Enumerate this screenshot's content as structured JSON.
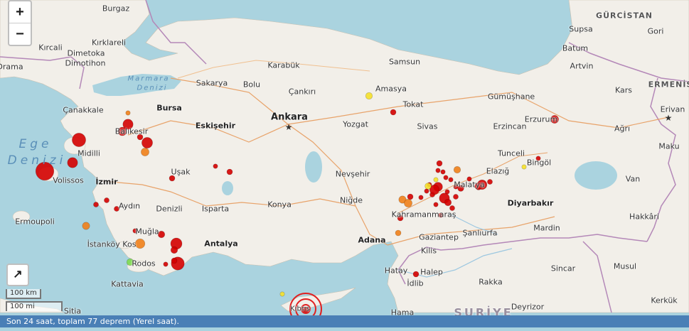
{
  "controls": {
    "zoom_in": "+",
    "zoom_out": "−",
    "fullscreen_glyph": "↗"
  },
  "scale": {
    "metric": "100 km",
    "imperial": "100 mi"
  },
  "status_text": "Son 24 saat, toplam 77 deprem (Yerel saat).",
  "colors": {
    "sea": "#aad3df",
    "land": "#f2efe9",
    "border": "#b488b8",
    "status_bar": "#4a7fb6",
    "quake_red": "#d40000",
    "quake_orange": "#f07f1a",
    "quake_yellow": "#f5e02a",
    "quake_green": "#7fdc50"
  },
  "labels": [
    {
      "text": "Burgaz"
    },
    {
      "text": "GÜRCİSTAN"
    },
    {
      "text": "Supsa"
    },
    {
      "text": "Gori"
    },
    {
      "text": "Kırklareli"
    },
    {
      "text": "Kırcali"
    },
    {
      "text": "Dimetoka"
    },
    {
      "text": "Batum"
    },
    {
      "text": "Dimotihon"
    },
    {
      "text": "Artvin"
    },
    {
      "text": "Drama"
    },
    {
      "text": "Karabük"
    },
    {
      "text": "Samsun"
    },
    {
      "text": "Marmara"
    },
    {
      "text": "Denizi"
    },
    {
      "text": "Sakarya"
    },
    {
      "text": "Bolu"
    },
    {
      "text": "Çankırı"
    },
    {
      "text": "Amasya"
    },
    {
      "text": "Kars"
    },
    {
      "text": "ERMENİS"
    },
    {
      "text": "Çanakkale"
    },
    {
      "text": "Bursa"
    },
    {
      "text": "Gümüşhane"
    },
    {
      "text": "Tokat"
    },
    {
      "text": "Erivan"
    },
    {
      "text": "Ankara"
    },
    {
      "text": "Balıkesir"
    },
    {
      "text": "Eskişehir"
    },
    {
      "text": "Yozgat"
    },
    {
      "text": "Sivas"
    },
    {
      "text": "Erzincan"
    },
    {
      "text": "Erzurum"
    },
    {
      "text": "Ağrı"
    },
    {
      "text": "Ege"
    },
    {
      "text": "Denizi"
    },
    {
      "text": "Midilli"
    },
    {
      "text": "Maku"
    },
    {
      "text": "Tunceli"
    },
    {
      "text": "Bingöl"
    },
    {
      "text": "Uşak"
    },
    {
      "text": "Volissos"
    },
    {
      "text": "Nevşehir"
    },
    {
      "text": "Elazığ"
    },
    {
      "text": "İzmir"
    },
    {
      "text": "Malatya"
    },
    {
      "text": "Van"
    },
    {
      "text": "Niğde"
    },
    {
      "text": "Aydın"
    },
    {
      "text": "Denizli"
    },
    {
      "text": "Isparta"
    },
    {
      "text": "Konya"
    },
    {
      "text": "Diyarbakır"
    },
    {
      "text": "Kahramanmaraş"
    },
    {
      "text": "Ermoupoli"
    },
    {
      "text": "Hakkâri"
    },
    {
      "text": "Muğla"
    },
    {
      "text": "Mardin"
    },
    {
      "text": "Gaziantep"
    },
    {
      "text": "Şanlıurfa"
    },
    {
      "text": "Adana"
    },
    {
      "text": "İstanköy Kos"
    },
    {
      "text": "Antalya"
    },
    {
      "text": "Kilis"
    },
    {
      "text": "Rodos"
    },
    {
      "text": "Sincar"
    },
    {
      "text": "Musul"
    },
    {
      "text": "Hatay"
    },
    {
      "text": "Halep"
    },
    {
      "text": "Kattavia"
    },
    {
      "text": "İdlib"
    },
    {
      "text": "Rakka"
    },
    {
      "text": "Kerkük"
    },
    {
      "text": "Deyrizor"
    },
    {
      "text": "Sitia"
    },
    {
      "text": "Hama"
    },
    {
      "text": "SURİYE"
    },
    {
      "text": "Kıbrıs"
    }
  ],
  "earthquakes": [
    {
      "id": "q1",
      "color": "red",
      "mag": 4.4
    },
    {
      "id": "q2",
      "color": "red",
      "mag": 3.6
    },
    {
      "id": "q3",
      "color": "red",
      "mag": 3.0
    },
    {
      "id": "q4",
      "color": "orange",
      "mag": 2.0
    },
    {
      "id": "q5",
      "color": "red",
      "mag": 3.0
    },
    {
      "id": "q6",
      "color": "red",
      "mag": 2.7
    },
    {
      "id": "q7",
      "color": "red",
      "mag": 2.2
    },
    {
      "id": "q8",
      "color": "orange",
      "mag": 2.6
    },
    {
      "id": "q9",
      "color": "red",
      "mag": 3.1
    },
    {
      "id": "q10",
      "color": "red",
      "mag": 2.2
    },
    {
      "id": "q11",
      "color": "red",
      "mag": 2.0
    },
    {
      "id": "q12",
      "color": "red",
      "mag": 2.2
    },
    {
      "id": "q13",
      "color": "red",
      "mag": 2.1
    },
    {
      "id": "q14",
      "color": "red",
      "mag": 2.1
    },
    {
      "id": "q15",
      "color": "red",
      "mag": 2.1
    },
    {
      "id": "q16",
      "color": "orange",
      "mag": 2.5
    },
    {
      "id": "q17",
      "color": "red",
      "mag": 2.0
    },
    {
      "id": "q18",
      "color": "red",
      "mag": 2.4
    },
    {
      "id": "q19",
      "color": "orange",
      "mag": 2.9
    },
    {
      "id": "q20",
      "color": "red",
      "mag": 3.2
    },
    {
      "id": "q21",
      "color": "red",
      "mag": 2.4
    },
    {
      "id": "q22",
      "color": "red",
      "mag": 3.5
    },
    {
      "id": "q23",
      "color": "green",
      "mag": 2.4
    },
    {
      "id": "q24",
      "color": "red",
      "mag": 2.0
    },
    {
      "id": "q25",
      "color": "red",
      "mag": 2.2
    },
    {
      "id": "q26",
      "color": "red",
      "mag": 2.2
    },
    {
      "id": "q27",
      "color": "yellow",
      "mag": 2.4
    },
    {
      "id": "q28",
      "color": "red",
      "mag": 2.8
    },
    {
      "id": "q29",
      "color": "red",
      "mag": 2.1
    },
    {
      "id": "q30",
      "color": "red",
      "mag": 2.2
    },
    {
      "id": "q31",
      "color": "red",
      "mag": 2.0
    },
    {
      "id": "q32",
      "color": "orange",
      "mag": 2.5
    },
    {
      "id": "q33",
      "color": "red",
      "mag": 2.2
    },
    {
      "id": "q34",
      "color": "yellow",
      "mag": 2.0
    },
    {
      "id": "q35",
      "color": "red",
      "mag": 2.0
    },
    {
      "id": "q36",
      "color": "red",
      "mag": 3.0
    },
    {
      "id": "q37",
      "color": "red",
      "mag": 2.4
    },
    {
      "id": "q38",
      "color": "orange",
      "mag": 2.2
    },
    {
      "id": "q39",
      "color": "red",
      "mag": 2.2
    },
    {
      "id": "q40",
      "color": "red",
      "mag": 2.9
    },
    {
      "id": "q41",
      "color": "red",
      "mag": 2.3
    },
    {
      "id": "q42",
      "color": "red",
      "mag": 2.1
    },
    {
      "id": "q43",
      "color": "red",
      "mag": 2.0
    },
    {
      "id": "q44",
      "color": "red",
      "mag": 2.0
    },
    {
      "id": "q45",
      "color": "orange",
      "mag": 2.4
    },
    {
      "id": "q46",
      "color": "yellow",
      "mag": 2.0
    },
    {
      "id": "q47",
      "color": "red",
      "mag": 2.0
    },
    {
      "id": "q48",
      "color": "red",
      "mag": 2.6
    },
    {
      "id": "q49",
      "color": "red",
      "mag": 2.1
    },
    {
      "id": "q50",
      "color": "red",
      "mag": 2.2
    },
    {
      "id": "q51",
      "color": "yellow",
      "mag": 2.0
    },
    {
      "id": "q52",
      "color": "red",
      "mag": 2.0
    },
    {
      "id": "q53",
      "color": "red",
      "mag": 2.0
    },
    {
      "id": "q54",
      "color": "red",
      "mag": 2.9
    },
    {
      "id": "q55",
      "color": "red",
      "mag": 2.0
    },
    {
      "id": "q56",
      "color": "red",
      "mag": 2.1
    },
    {
      "id": "q57",
      "color": "red",
      "mag": 2.3
    },
    {
      "id": "q58",
      "color": "orange",
      "mag": 2.6
    },
    {
      "id": "q59",
      "color": "red",
      "mag": 2.0
    },
    {
      "id": "q60",
      "color": "red",
      "mag": 2.0
    },
    {
      "id": "q61",
      "color": "red",
      "mag": 2.0
    },
    {
      "id": "q62",
      "color": "red",
      "mag": 2.3
    },
    {
      "id": "q63",
      "color": "red",
      "mag": 2.0
    },
    {
      "id": "q64",
      "color": "red",
      "mag": 2.0
    },
    {
      "id": "q65",
      "color": "yellow",
      "mag": 2.3
    },
    {
      "id": "q66",
      "color": "red",
      "mag": 2.2
    }
  ]
}
